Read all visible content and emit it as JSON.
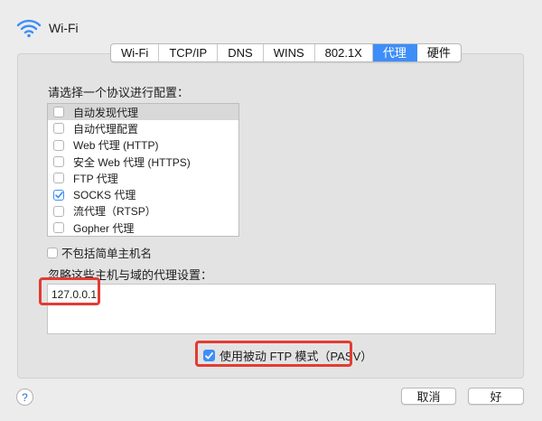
{
  "header": {
    "title": "Wi-Fi",
    "icon": "wifi-icon"
  },
  "tabs": [
    {
      "label": "Wi-Fi",
      "active": false
    },
    {
      "label": "TCP/IP",
      "active": false
    },
    {
      "label": "DNS",
      "active": false
    },
    {
      "label": "WINS",
      "active": false
    },
    {
      "label": "802.1X",
      "active": false
    },
    {
      "label": "代理",
      "active": true
    },
    {
      "label": "硬件",
      "active": false
    }
  ],
  "protocols": {
    "prompt": "请选择一个协议进行配置：",
    "items": [
      {
        "label": "自动发现代理",
        "checked": false,
        "selected": true
      },
      {
        "label": "自动代理配置",
        "checked": false,
        "selected": false
      },
      {
        "label": "Web 代理 (HTTP)",
        "checked": false,
        "selected": false
      },
      {
        "label": "安全 Web 代理 (HTTPS)",
        "checked": false,
        "selected": false
      },
      {
        "label": "FTP 代理",
        "checked": false,
        "selected": false
      },
      {
        "label": "SOCKS 代理",
        "checked": true,
        "selected": false
      },
      {
        "label": "流代理（RTSP）",
        "checked": false,
        "selected": false
      },
      {
        "label": "Gopher 代理",
        "checked": false,
        "selected": false
      }
    ]
  },
  "exclude_simple": {
    "label": "不包括简单主机名",
    "checked": false
  },
  "bypass": {
    "label": "忽略这些主机与域的代理设置：",
    "value": "127.0.0.1"
  },
  "pasv": {
    "label": "使用被动 FTP 模式（PASV）",
    "checked": true
  },
  "buttons": {
    "help": "?",
    "cancel": "取消",
    "ok": "好"
  },
  "colors": {
    "accent": "#3d8ef8",
    "highlight": "#e13c33"
  }
}
